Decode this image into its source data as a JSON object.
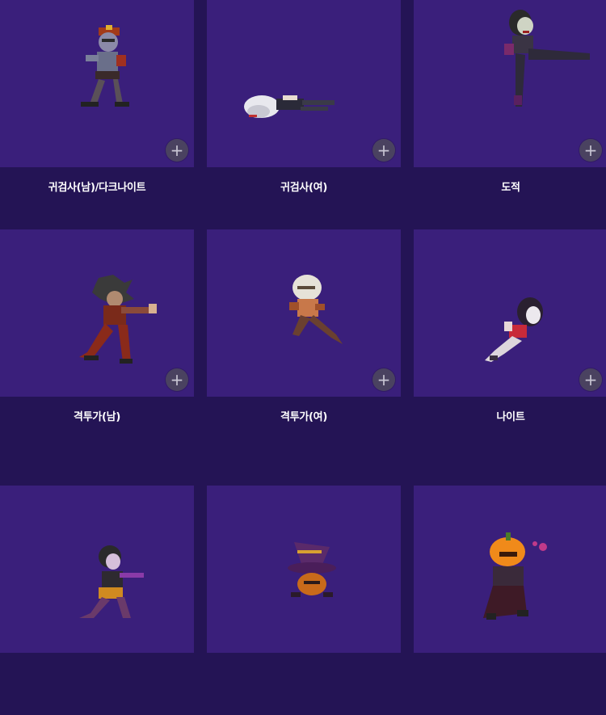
{
  "add_button_symbol": "+",
  "cards": [
    {
      "name": "귀검사(남)/다크나이트"
    },
    {
      "name": "귀검사(여)"
    },
    {
      "name": "도적"
    },
    {
      "name": "격투가(남)"
    },
    {
      "name": "격투가(여)"
    },
    {
      "name": "나이트"
    },
    {
      "name": ""
    },
    {
      "name": ""
    },
    {
      "name": ""
    }
  ],
  "colors": {
    "page_background": "#241455",
    "card_background": "#3a1f7b",
    "add_button": "#4a4260",
    "label_text": "#ffffff"
  }
}
